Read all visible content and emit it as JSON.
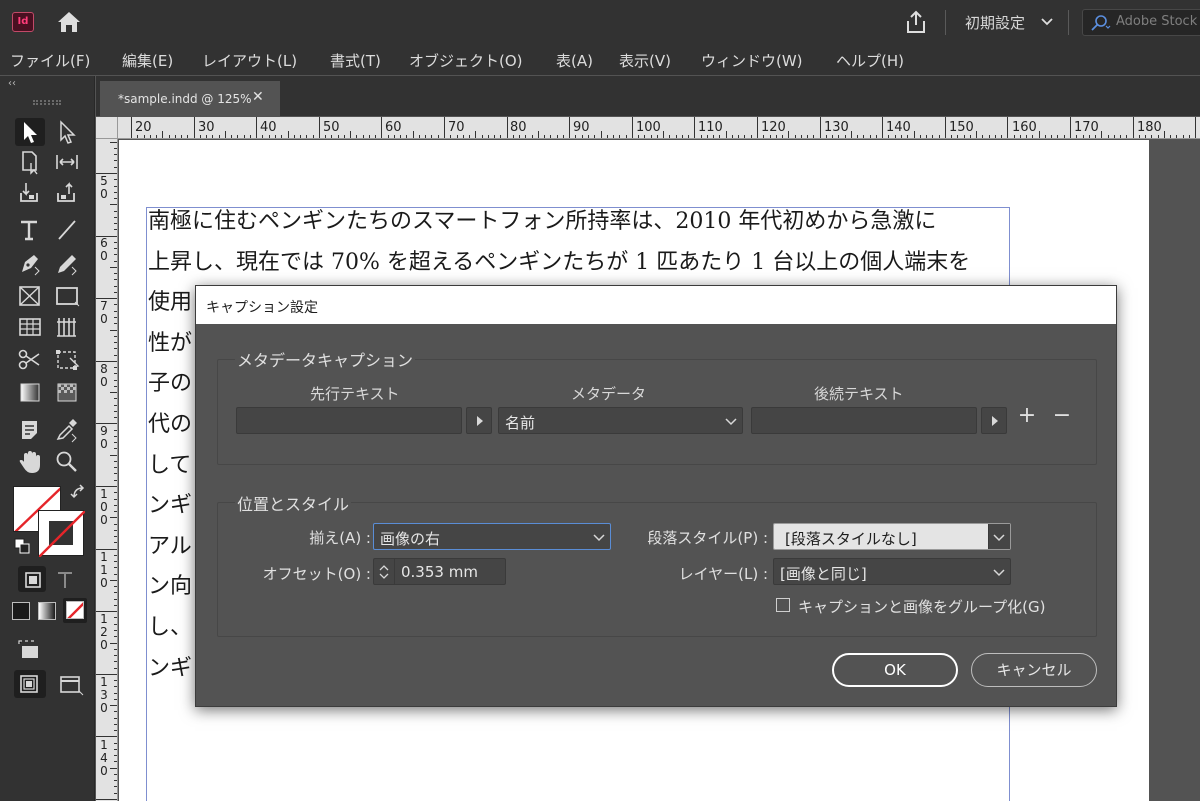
{
  "appbar": {
    "logo_text": "Id",
    "workspace": "初期設定",
    "stock_search_placeholder": "Adobe Stock"
  },
  "menu": [
    {
      "label": "ファイル(F)"
    },
    {
      "label": "編集(E)"
    },
    {
      "label": "レイアウト(L)"
    },
    {
      "label": "書式(T)"
    },
    {
      "label": "オブジェクト(O)"
    },
    {
      "label": "表(A)"
    },
    {
      "label": "表示(V)"
    },
    {
      "label": "ウィンドウ(W)"
    },
    {
      "label": "ヘルプ(H)"
    }
  ],
  "toolpanel": {
    "collapse_glyph": "‹‹"
  },
  "document_tab": {
    "label": "*sample.indd @ 125%",
    "close_glyph": "✕"
  },
  "ruler_h": [
    "20",
    "30",
    "40",
    "50",
    "60",
    "70",
    "80",
    "90",
    "100",
    "110",
    "120",
    "130",
    "140",
    "150",
    "160",
    "170",
    "180"
  ],
  "ruler_v": [
    "50",
    "60",
    "70",
    "80",
    "90",
    "100",
    "110",
    "120",
    "130",
    "140"
  ],
  "body_text_lines": [
    "南極に住むペンギンたちのスマートフォン所持率は、2010 年代初めから急激に",
    "上昇し、現在では 70% を超えるペンギンたちが 1 匹あたり 1 台以上の個人端末を",
    "使用",
    "性が",
    "子の",
    "代の",
    "して",
    "ンギ",
    "アル",
    "ン向",
    "し、",
    "ンギ"
  ],
  "dialog": {
    "title": "キャプション設定",
    "metadata_section": {
      "title": "メタデータキャプション",
      "col_leading": "先行テキスト",
      "col_metadata": "メタデータ",
      "col_trailing": "後続テキスト",
      "leading_value": "",
      "metadata_value": "名前",
      "trailing_value": "",
      "add_glyph": "+",
      "remove_glyph": "−"
    },
    "position_section": {
      "title": "位置とスタイル",
      "align_label": "揃え(A) :",
      "align_value": "画像の右",
      "offset_label": "オフセット(O) :",
      "offset_value": "0.353 mm",
      "para_style_label": "段落スタイル(P) :",
      "para_style_value": "[段落スタイルなし]",
      "layer_label": "レイヤー(L) :",
      "layer_value": "[画像と同じ]",
      "group_label": "キャプションと画像をグループ化(G)",
      "group_checked": false
    },
    "ok_label": "OK",
    "cancel_label": "キャンセル"
  },
  "colors": {
    "accent_red": "#e5252a",
    "focus_blue": "#5a8dd6"
  }
}
